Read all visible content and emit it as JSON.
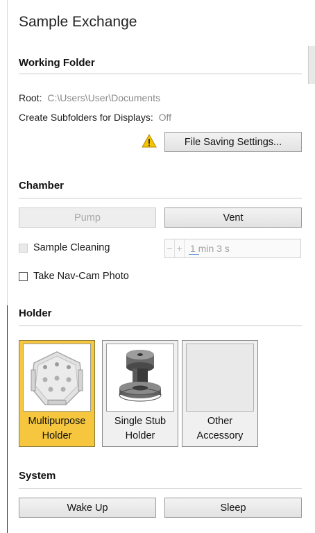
{
  "panel": {
    "title": "Sample Exchange"
  },
  "working_folder": {
    "section_title": "Working Folder",
    "root_label": "Root:",
    "root_value": "C:\\Users\\User\\Documents",
    "subfolders_label": "Create Subfolders for Displays:",
    "subfolders_value": "Off",
    "file_saving_button": "File Saving Settings..."
  },
  "chamber": {
    "section_title": "Chamber",
    "pump_button": "Pump",
    "vent_button": "Vent",
    "sample_cleaning_label": "Sample Cleaning",
    "cleaning_time_value": "1 min 3 s",
    "stepper_minus": "−",
    "stepper_plus": "+",
    "nav_cam_label": "Take Nav-Cam Photo"
  },
  "holder": {
    "section_title": "Holder",
    "items": [
      {
        "line1": "Multipurpose",
        "line2": "Holder",
        "selected": true
      },
      {
        "line1": "Single Stub",
        "line2": "Holder",
        "selected": false
      },
      {
        "line1": "Other",
        "line2": "Accessory",
        "selected": false
      }
    ]
  },
  "system": {
    "section_title": "System",
    "wake_button": "Wake Up",
    "sleep_button": "Sleep"
  },
  "colors": {
    "selected_holder": "#f6c73e",
    "warning": "#f5c400"
  },
  "icons": {
    "warning": "warning-triangle-icon"
  }
}
